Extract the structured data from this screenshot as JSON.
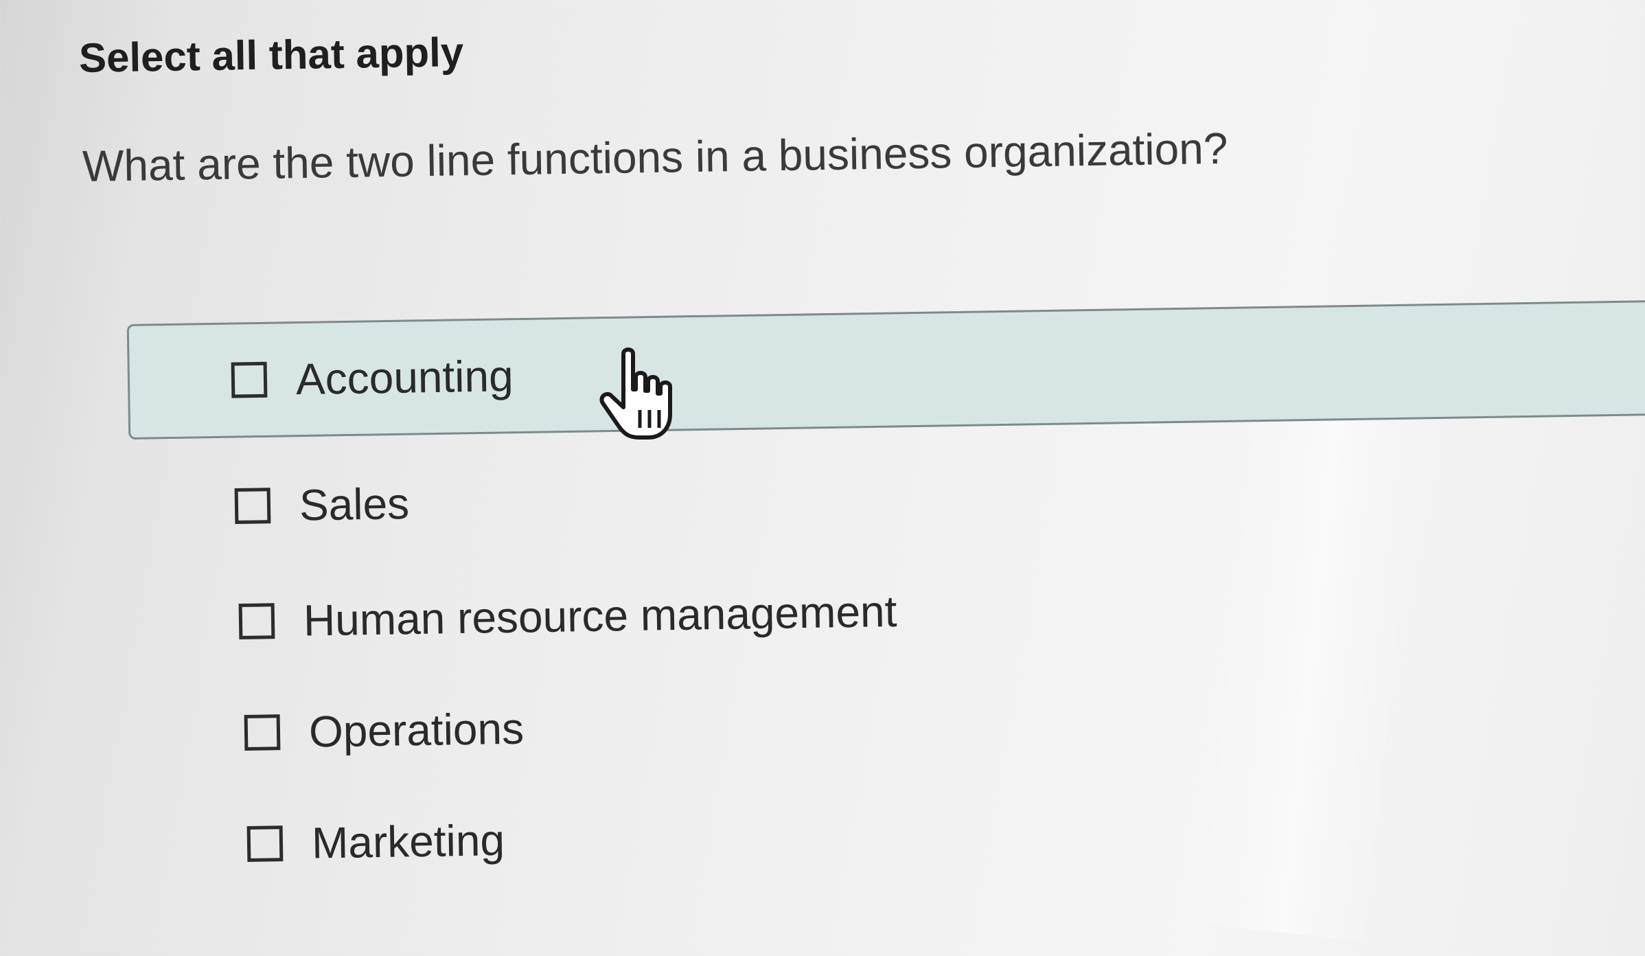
{
  "header": {
    "instruction": "Select all that apply",
    "question": "What are the two line functions in a business organization?"
  },
  "options": [
    {
      "label": "Accounting",
      "checked": false,
      "hovered": true
    },
    {
      "label": "Sales",
      "checked": false
    },
    {
      "label": "Human resource management",
      "checked": false
    },
    {
      "label": "Operations",
      "checked": false
    },
    {
      "label": "Marketing",
      "checked": false
    }
  ],
  "colors": {
    "hover_background": "#d8e5e5",
    "hover_border": "#7d8a8d",
    "text": "#2a2a2a"
  },
  "cursor": {
    "icon": "hand-pointer-icon"
  }
}
